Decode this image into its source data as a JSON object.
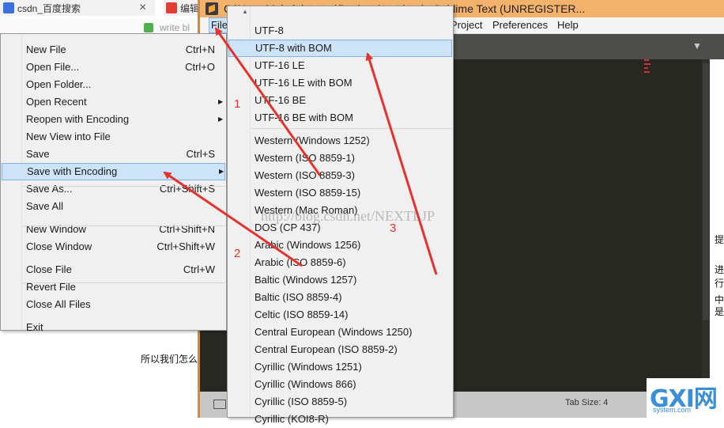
{
  "browser": {
    "tabs": [
      {
        "label": "csdn_百度搜索",
        "close": "×"
      },
      {
        "label": "编辑"
      }
    ],
    "addr_text": "write bl",
    "page_texts": [
      "所以我们怎么"
    ],
    "side_chars": [
      "提",
      "进行",
      "中",
      "是"
    ]
  },
  "sublime": {
    "title": "C:\\Users\\Administrator\\Desktop\\test.html - Sublime Text (UNREGISTER...",
    "menubar": [
      {
        "label": "File"
      },
      {
        "label": "Project"
      },
      {
        "label": "Preferences"
      },
      {
        "label": "Help"
      }
    ],
    "tab_dropdown": "▼",
    "status_tab_size": "Tab Size: 4"
  },
  "file_menu": {
    "items": [
      {
        "label": "New File",
        "shortcut": "Ctrl+N"
      },
      {
        "label": "Open File...",
        "shortcut": "Ctrl+O"
      },
      {
        "label": "Open Folder...",
        "shortcut": ""
      },
      {
        "label": "Open Recent",
        "shortcut": "",
        "submenu": true
      },
      {
        "label": "Reopen with Encoding",
        "shortcut": "",
        "submenu": true
      },
      {
        "label": "New View into File",
        "shortcut": ""
      },
      {
        "label": "Save",
        "shortcut": "Ctrl+S"
      },
      {
        "label": "Save with Encoding",
        "shortcut": "",
        "submenu": true,
        "highlighted": true
      },
      {
        "label": "Save As...",
        "shortcut": "Ctrl+Shift+S"
      },
      {
        "label": "Save All",
        "shortcut": ""
      },
      {
        "label": "New Window",
        "shortcut": "Ctrl+Shift+N"
      },
      {
        "label": "Close Window",
        "shortcut": "Ctrl+Shift+W"
      },
      {
        "label": "Close File",
        "shortcut": "Ctrl+W"
      },
      {
        "label": "Revert File",
        "shortcut": ""
      },
      {
        "label": "Close All Files",
        "shortcut": ""
      },
      {
        "label": "Exit",
        "shortcut": ""
      }
    ]
  },
  "encoding_menu": {
    "items": [
      {
        "label": "UTF-8"
      },
      {
        "label": "UTF-8 with BOM",
        "highlighted": true
      },
      {
        "label": "UTF-16 LE"
      },
      {
        "label": "UTF-16 LE with BOM"
      },
      {
        "label": "UTF-16 BE"
      },
      {
        "label": "UTF-16 BE with BOM"
      },
      {
        "label": "Western (Windows 1252)"
      },
      {
        "label": "Western (ISO 8859-1)"
      },
      {
        "label": "Western (ISO 8859-3)"
      },
      {
        "label": "Western (ISO 8859-15)"
      },
      {
        "label": "Western (Mac Roman)"
      },
      {
        "label": "DOS (CP 437)"
      },
      {
        "label": "Arabic (Windows 1256)"
      },
      {
        "label": "Arabic (ISO 8859-6)"
      },
      {
        "label": "Baltic (Windows 1257)"
      },
      {
        "label": "Baltic (ISO 8859-4)"
      },
      {
        "label": "Celtic (ISO 8859-14)"
      },
      {
        "label": "Central European (Windows 1250)"
      },
      {
        "label": "Central European (ISO 8859-2)"
      },
      {
        "label": "Cyrillic (Windows 1251)"
      },
      {
        "label": "Cyrillic (Windows 866)"
      },
      {
        "label": "Cyrillic (ISO 8859-5)"
      },
      {
        "label": "Cyrillic (KOI8-R)"
      }
    ]
  },
  "annotations": {
    "step1": "1",
    "step2": "2",
    "step3": "3",
    "arrow_color": "#e5322d",
    "watermark": "http://blog.csdn.net/NEXTLJP"
  },
  "logo": {
    "main": "GXI网",
    "sub": "system.com"
  },
  "colors": {
    "highlight_bg": "#cde3f7",
    "highlight_border": "#7eb4ea",
    "title_bar": "#f3b26c",
    "editor_bg": "#272822"
  }
}
